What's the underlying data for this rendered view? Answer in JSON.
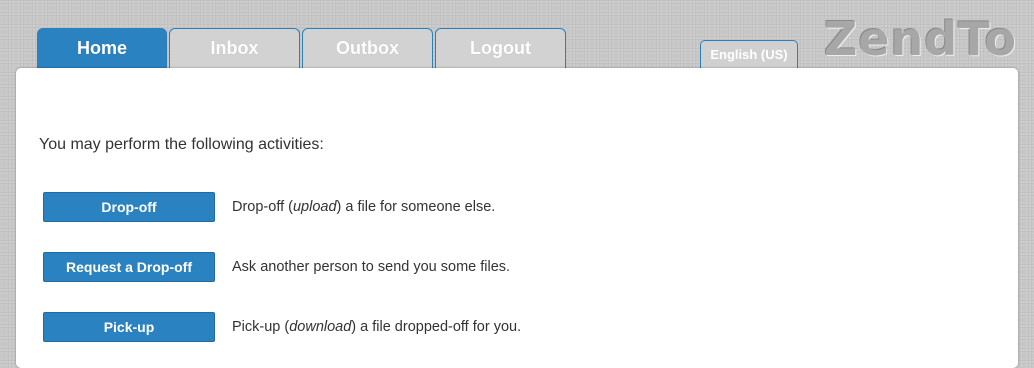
{
  "logo": "ZendTo",
  "tabs": [
    {
      "label": "Home"
    },
    {
      "label": "Inbox"
    },
    {
      "label": "Outbox"
    },
    {
      "label": "Logout"
    }
  ],
  "language": "English (US)",
  "intro": "You may perform the following activities:",
  "actions": [
    {
      "button": "Drop-off",
      "desc_pre": "Drop-off (",
      "desc_em": "upload",
      "desc_post": ") a file for someone else."
    },
    {
      "button": "Request a Drop-off",
      "desc_pre": "Ask another person to send you some files.",
      "desc_em": "",
      "desc_post": ""
    },
    {
      "button": "Pick-up",
      "desc_pre": "Pick-up (",
      "desc_em": "download",
      "desc_post": ") a file dropped-off for you."
    }
  ],
  "colors": {
    "accent": "#2a82c0",
    "background": "#c9c9c9",
    "panel": "#ffffff"
  }
}
